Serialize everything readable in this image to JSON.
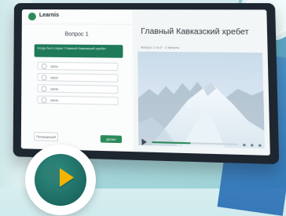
{
  "app": {
    "name": "Learnis"
  },
  "left_panel": {
    "question_title": "Вопрос 1",
    "prompt": "Когда был открыт Главный Кавказский хребет",
    "options": [
      "1821г",
      "1822г",
      "1823г",
      "1824г"
    ],
    "back_label": "Предыдущий",
    "next_label": "Далее"
  },
  "right_panel": {
    "heading": "Главный Кавказский хребет",
    "meta": "Вопрос 1 из 5 · 2 минуты",
    "video": {
      "progress_percent": 46
    }
  }
}
